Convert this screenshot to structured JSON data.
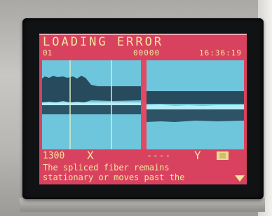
{
  "screen": {
    "title": "LOADING ERROR",
    "fiber_count": "01",
    "splice_count": "00000",
    "clock": "16:36:19"
  },
  "status_bar": {
    "tension_value": "1300",
    "x_mark": "X",
    "y_mark": "Y",
    "dash_mark": "----",
    "camera_icon": "camera-icon"
  },
  "message": {
    "line1": "The spliced fiber remains",
    "line2": "stationary or moves past the"
  },
  "colors": {
    "screen_bg": "#d9425f",
    "text": "#f1e79c",
    "view_bg": "#6ec6dc",
    "fiber_dark": "#274a5c"
  }
}
